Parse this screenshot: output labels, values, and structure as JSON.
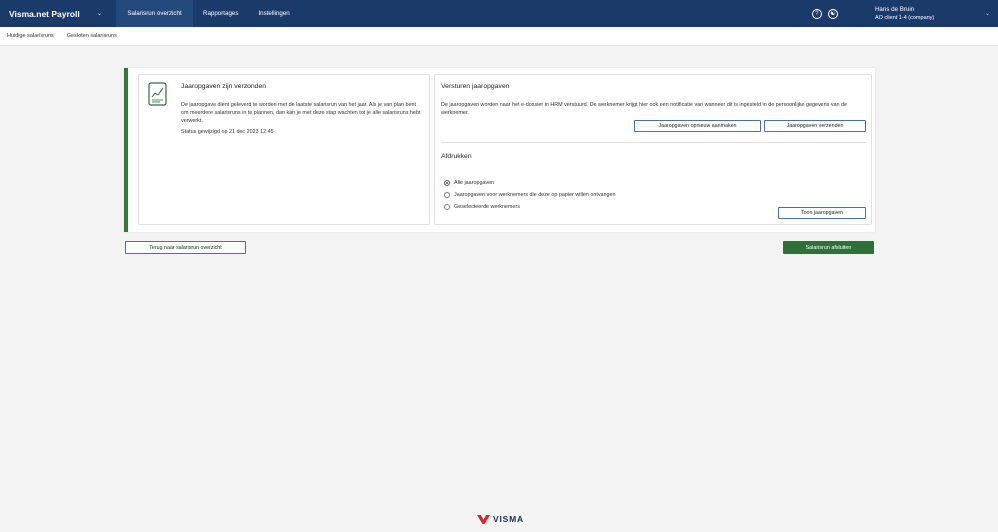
{
  "app": {
    "brand": "Visma.net Payroll"
  },
  "nav": {
    "items": [
      {
        "label": "Salarisrun overzicht",
        "active": true
      },
      {
        "label": "Rapportages",
        "active": false
      },
      {
        "label": "Instellingen",
        "active": false
      }
    ]
  },
  "user": {
    "name": "Hans de Bruin",
    "client": "AO client 1-4 (company)"
  },
  "icons": {
    "help": "help-circle-icon",
    "accessibility": "accessibility-icon",
    "user_menu": "chevron-down-icon",
    "brand_menu": "chevron-down-icon"
  },
  "subnav": {
    "items": [
      "Huidige salarisruns",
      "Gesloten salarisruns"
    ]
  },
  "left_panel": {
    "title": "Jaaropgaven zijn verzonden",
    "text": "De jaaropgave dient geleverd te worden met de laatste salarisrun van het jaar. Als je van plan bent om meerdere salarisruns in te plannen, dan kan je met deze stap wachten tot je alle salarisruns hebt verwerkt.",
    "status": "Status gewijzigd op 21 dec 2023 12:45"
  },
  "right_panel": {
    "title": "Versturen jaaropgaven",
    "text": "De jaaropgaven worden naar het e-dossier in HRM verstuurd. De werknemer krijgt hier ook een notificatie van wanneer dit is ingesteld in de persoonlijke gegevens van de werknemer.",
    "recreate_button": "Jaaropgaven opnieuw aanmaken",
    "send_button": "Jaaropgaven verzenden",
    "print_title": "Afdrukken",
    "radio_options": [
      {
        "label": "Alle jaaropgaven",
        "checked": true
      },
      {
        "label": "Jaaropgaven voor werknemers die deze op papier willen ontvangen",
        "checked": false
      },
      {
        "label": "Geselecteerde werknemers",
        "checked": false
      }
    ],
    "show_button": "Toon jaaropgaven"
  },
  "footer": {
    "back_button": "Terug naar salarisrun overzicht",
    "close_button": "Salarisrun afsluiten",
    "logo": "VISMA"
  },
  "colors": {
    "navbar": "#1a3a6a",
    "nav_active": "#24497d",
    "accent_green": "#2f6f3a",
    "card_border": "#2e7d32",
    "logo_red": "#d8262e"
  }
}
